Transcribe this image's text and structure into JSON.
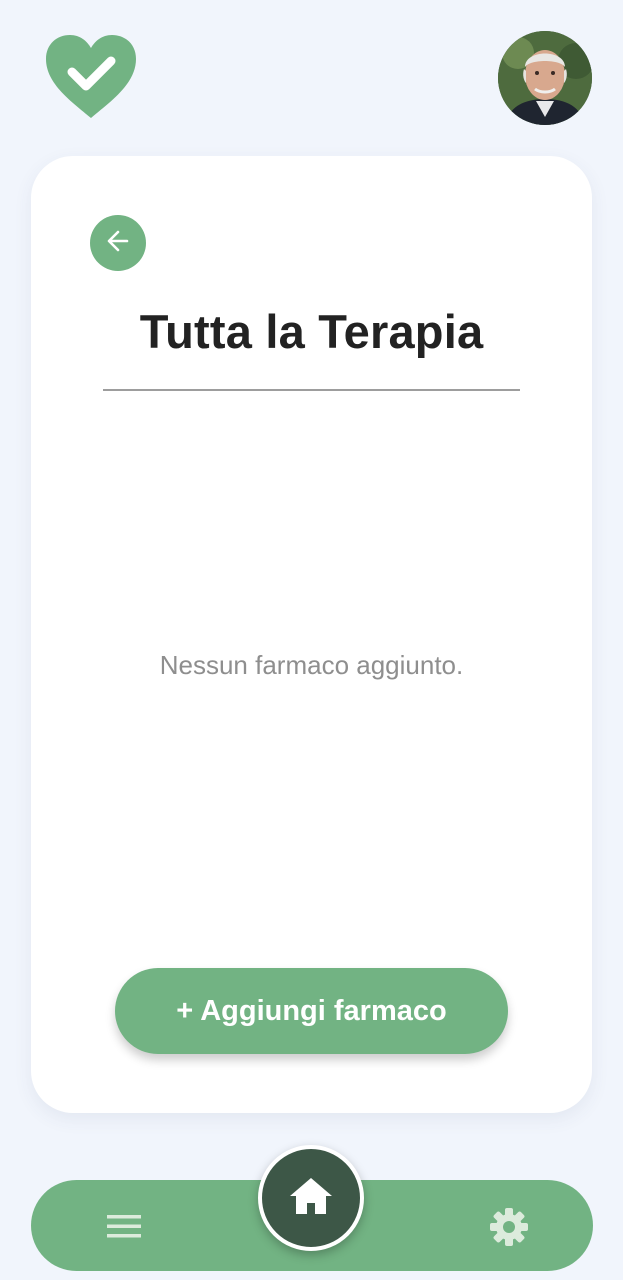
{
  "header": {
    "logo_icon": "heart-check-icon",
    "avatar": "user-avatar-photo"
  },
  "card": {
    "back_icon": "arrow-left-icon",
    "title": "Tutta la Terapia",
    "empty_message": "Nessun farmaco aggiunto.",
    "add_button_label": "+ Aggiungi farmaco"
  },
  "bottom_nav": {
    "menu_icon": "hamburger-menu-icon",
    "home_icon": "home-icon",
    "settings_icon": "gear-icon"
  },
  "colors": {
    "accent": "#72b383",
    "home_button": "#3d5747",
    "background": "#f1f5fc",
    "title_text": "#222222",
    "muted_text": "#8e8e8e"
  }
}
